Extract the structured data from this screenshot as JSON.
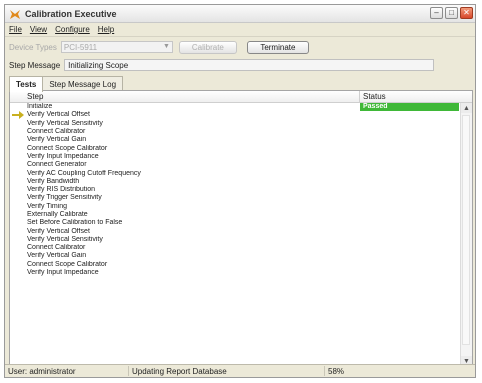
{
  "window": {
    "title": "Calibration Executive"
  },
  "menu": [
    "File",
    "View",
    "Configure",
    "Help"
  ],
  "toolbar": {
    "device_types_label": "Device Types",
    "device_types_value": "PCI-5911",
    "calibrate_label": "Calibrate",
    "terminate_label": "Terminate"
  },
  "step_message": {
    "label": "Step Message",
    "value": "Initializing Scope"
  },
  "tabs": [
    {
      "label": "Tests",
      "active": true
    },
    {
      "label": "Step Message Log",
      "active": false
    }
  ],
  "table": {
    "columns": [
      "Step",
      "Status"
    ],
    "rows": [
      {
        "step": "Initialize",
        "status": "Passed"
      },
      {
        "step": "Verify Vertical Offset",
        "status": "",
        "current": true
      },
      {
        "step": "Verify Vertical Sensitivity",
        "status": ""
      },
      {
        "step": "Connect Calibrator",
        "status": ""
      },
      {
        "step": "Verify Vertical Gain",
        "status": ""
      },
      {
        "step": "Connect Scope Calibrator",
        "status": ""
      },
      {
        "step": "Verify Input Impedance",
        "status": ""
      },
      {
        "step": "Connect Generator",
        "status": ""
      },
      {
        "step": "Verify AC Coupling Cutoff Frequency",
        "status": ""
      },
      {
        "step": "Verify Bandwidth",
        "status": ""
      },
      {
        "step": "Verify RIS Distribution",
        "status": ""
      },
      {
        "step": "Verify Trigger Sensitivity",
        "status": ""
      },
      {
        "step": "Verify Timing",
        "status": ""
      },
      {
        "step": "Externally Calibrate",
        "status": ""
      },
      {
        "step": "Set Before Calibration to False",
        "status": ""
      },
      {
        "step": "Verify Vertical Offset",
        "status": ""
      },
      {
        "step": "Verify Vertical Sensitivity",
        "status": ""
      },
      {
        "step": "Connect Calibrator",
        "status": ""
      },
      {
        "step": "Verify Vertical Gain",
        "status": ""
      },
      {
        "step": "Connect Scope Calibrator",
        "status": ""
      },
      {
        "step": "Verify Input Impedance",
        "status": ""
      }
    ]
  },
  "statusbar": {
    "user": "User: administrator",
    "message": "Updating Report Database",
    "progress": "58%"
  }
}
